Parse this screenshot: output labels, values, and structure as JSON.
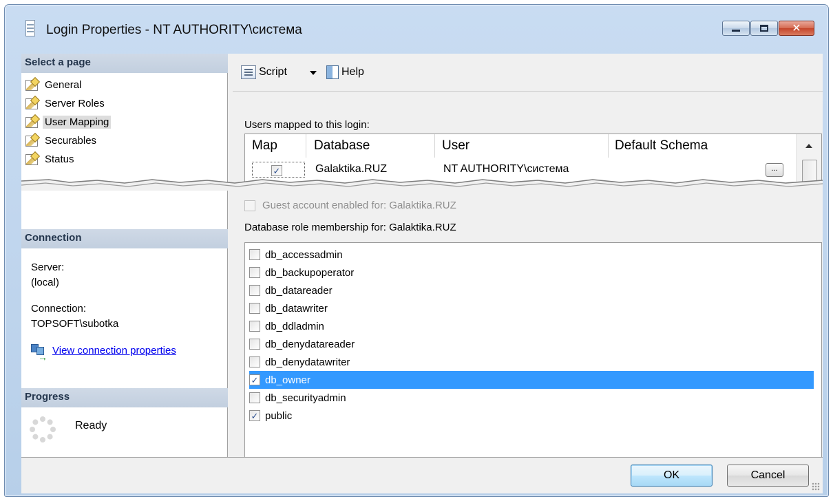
{
  "window": {
    "title": "Login Properties - NT AUTHORITY\\система"
  },
  "left_pane": {
    "select_page_header": "Select a page",
    "pages": [
      {
        "label": "General",
        "selected": false
      },
      {
        "label": "Server Roles",
        "selected": false
      },
      {
        "label": "User Mapping",
        "selected": true
      },
      {
        "label": "Securables",
        "selected": false
      },
      {
        "label": "Status",
        "selected": false
      }
    ],
    "connection_header": "Connection",
    "server_label": "Server:",
    "server_value": "(local)",
    "connection_label": "Connection:",
    "connection_value": "TOPSOFT\\subotka",
    "view_connection_link": "View connection properties",
    "progress_header": "Progress",
    "progress_status": "Ready"
  },
  "toolbar": {
    "script_label": "Script",
    "help_label": "Help"
  },
  "users_mapping": {
    "label": "Users mapped to this login:",
    "columns": [
      "Map",
      "Database",
      "User",
      "Default Schema"
    ],
    "rows": [
      {
        "map": true,
        "database": "Galaktika.RUZ",
        "user": "NT AUTHORITY\\система",
        "default_schema": "",
        "browse_label": "..."
      }
    ]
  },
  "guest_account": {
    "label": "Guest account enabled for: Galaktika.RUZ",
    "checked": false,
    "enabled": false
  },
  "role_membership": {
    "label": "Database role membership for: Galaktika.RUZ",
    "roles": [
      {
        "name": "db_accessadmin",
        "checked": false
      },
      {
        "name": "db_backupoperator",
        "checked": false
      },
      {
        "name": "db_datareader",
        "checked": false
      },
      {
        "name": "db_datawriter",
        "checked": false
      },
      {
        "name": "db_ddladmin",
        "checked": false
      },
      {
        "name": "db_denydatareader",
        "checked": false
      },
      {
        "name": "db_denydatawriter",
        "checked": false
      },
      {
        "name": "db_owner",
        "checked": true,
        "selected": true
      },
      {
        "name": "db_securityadmin",
        "checked": false
      },
      {
        "name": "public",
        "checked": true
      }
    ]
  },
  "buttons": {
    "ok": "OK",
    "cancel": "Cancel"
  },
  "colors": {
    "selection": "#3399ff",
    "section_header": "#c2cfdf",
    "link": "#0000ee"
  }
}
